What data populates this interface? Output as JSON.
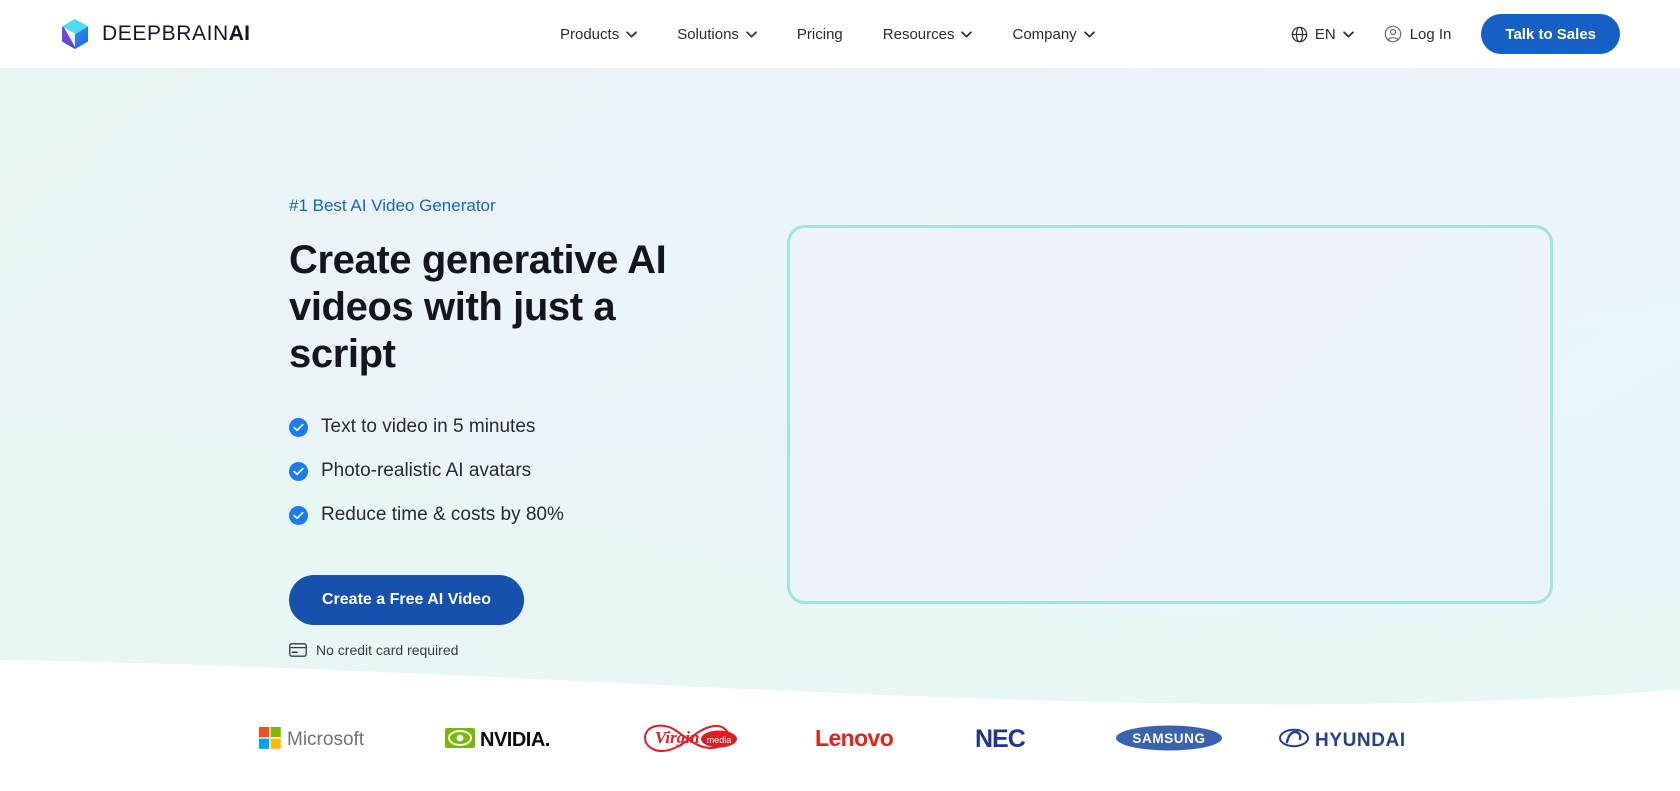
{
  "header": {
    "logo": {
      "icon": "deepbrain-cube-icon",
      "name_main": "DEEPBRAIN",
      "name_accent": "AI"
    },
    "nav": [
      {
        "label": "Products",
        "has_dropdown": true
      },
      {
        "label": "Solutions",
        "has_dropdown": true
      },
      {
        "label": "Pricing",
        "has_dropdown": false
      },
      {
        "label": "Resources",
        "has_dropdown": true
      },
      {
        "label": "Company",
        "has_dropdown": true
      }
    ],
    "language": {
      "icon": "globe-icon",
      "label": "EN",
      "has_dropdown": true
    },
    "login": {
      "icon": "user-circle-icon",
      "label": "Log In"
    },
    "cta": {
      "label": "Talk to Sales",
      "color": "#1560c4"
    }
  },
  "hero": {
    "eyebrow": "#1 Best AI Video Generator",
    "headline_line1": "Create generative AI",
    "headline_line2": "videos with just a script",
    "bullets": [
      {
        "icon": "check-circle-icon",
        "label": "Text to video in 5 minutes"
      },
      {
        "icon": "check-circle-icon",
        "label": "Photo-realistic AI avatars"
      },
      {
        "icon": "check-circle-icon",
        "label": "Reduce time & costs by 80%"
      }
    ],
    "cta": {
      "label": "Create a Free AI Video",
      "color": "#1551ad"
    },
    "note": {
      "icon": "credit-card-icon",
      "label": "No credit card required"
    },
    "video_panel": {
      "border_color": "#9fe8d8"
    }
  },
  "brands": [
    {
      "name": "Microsoft",
      "icon": "microsoft-logo"
    },
    {
      "name": "NVIDIA",
      "icon": "nvidia-logo"
    },
    {
      "name": "Virgin Media",
      "icon": "virgin-media-logo"
    },
    {
      "name": "Lenovo",
      "icon": "lenovo-logo"
    },
    {
      "name": "NEC",
      "icon": "nec-logo"
    },
    {
      "name": "SAMSUNG",
      "icon": "samsung-logo"
    },
    {
      "name": "HYUNDAI",
      "icon": "hyundai-logo"
    }
  ],
  "theme": {
    "accent_blue": "#1560c4",
    "check_blue": "#1a7cf0",
    "eyebrow_blue": "#1a63c8",
    "mint_border": "#9fe8d8",
    "bg_top": "#eaf1fb",
    "bg_mint": "#e9f7f4"
  }
}
